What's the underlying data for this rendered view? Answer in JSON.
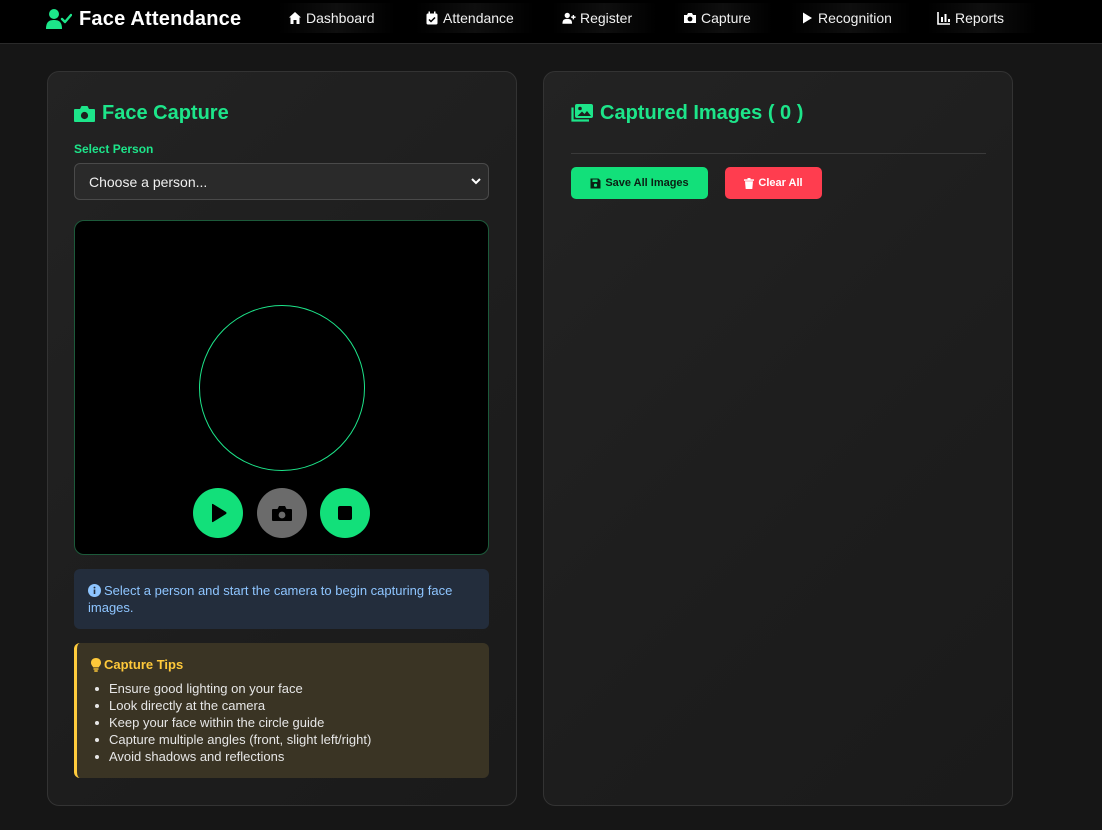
{
  "app": {
    "title": "Face Attendance"
  },
  "nav": {
    "items": [
      {
        "label": "Dashboard",
        "icon": "home-icon"
      },
      {
        "label": "Attendance",
        "icon": "calendar-check-icon"
      },
      {
        "label": "Register",
        "icon": "user-plus-icon"
      },
      {
        "label": "Capture",
        "icon": "camera-icon"
      },
      {
        "label": "Recognition",
        "icon": "play-icon"
      },
      {
        "label": "Reports",
        "icon": "chart-icon"
      }
    ]
  },
  "capture": {
    "title": "Face Capture",
    "select_label": "Select Person",
    "select_value": "Choose a person...",
    "info_text": "Select a person and start the camera to begin capturing face images.",
    "tips": {
      "title": "Capture Tips",
      "items": [
        "Ensure good lighting on your face",
        "Look directly at the camera",
        "Keep your face within the circle guide",
        "Capture multiple angles (front, slight left/right)",
        "Avoid shadows and reflections"
      ]
    }
  },
  "captured": {
    "title": "Captured Images ( 0 )",
    "save_label": "Save All Images",
    "clear_label": "Clear All"
  },
  "colors": {
    "accent": "#1de58a",
    "danger": "#ff3d4f",
    "info": "#8ec5ff",
    "warning": "#ffc93a",
    "background": "#161616"
  }
}
